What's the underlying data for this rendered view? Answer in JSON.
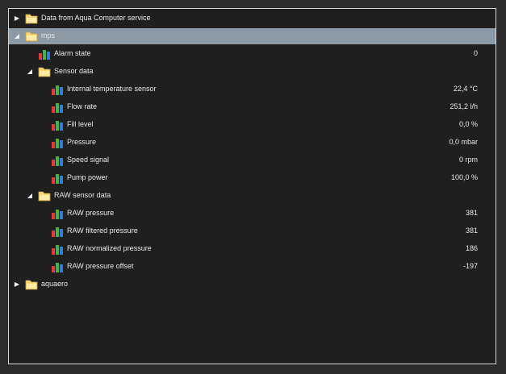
{
  "tree": {
    "root": {
      "label": "Data from Aqua Computer service"
    },
    "mps": {
      "label": "mps",
      "alarm": {
        "label": "Alarm state",
        "value": "0"
      },
      "sensor": {
        "label": "Sensor data",
        "items": [
          {
            "label": "Internal temperature sensor",
            "value": "22,4 °C"
          },
          {
            "label": "Flow rate",
            "value": "251,2 l/h"
          },
          {
            "label": "Fill level",
            "value": "0,0 %"
          },
          {
            "label": "Pressure",
            "value": "0,0 mbar"
          },
          {
            "label": "Speed signal",
            "value": "0 rpm"
          },
          {
            "label": "Pump power",
            "value": "100,0 %"
          }
        ]
      },
      "raw": {
        "label": "RAW sensor data",
        "items": [
          {
            "label": "RAW pressure",
            "value": "381"
          },
          {
            "label": "RAW filtered pressure",
            "value": "381"
          },
          {
            "label": "RAW normalized pressure",
            "value": "186"
          },
          {
            "label": "RAW pressure offset",
            "value": "-197"
          }
        ]
      }
    },
    "aquaero": {
      "label": "aquaero"
    }
  },
  "colors": {
    "selection": "#8c9aa6",
    "folder": "#f6d77a",
    "bar_red": "#e23b3b",
    "bar_green": "#49b34a",
    "bar_blue": "#3a7bd5"
  },
  "icons": {
    "collapsed": "triangle-right-icon",
    "expanded": "triangle-down-icon",
    "folder": "folder-icon",
    "sensor": "bar-chart-icon"
  }
}
